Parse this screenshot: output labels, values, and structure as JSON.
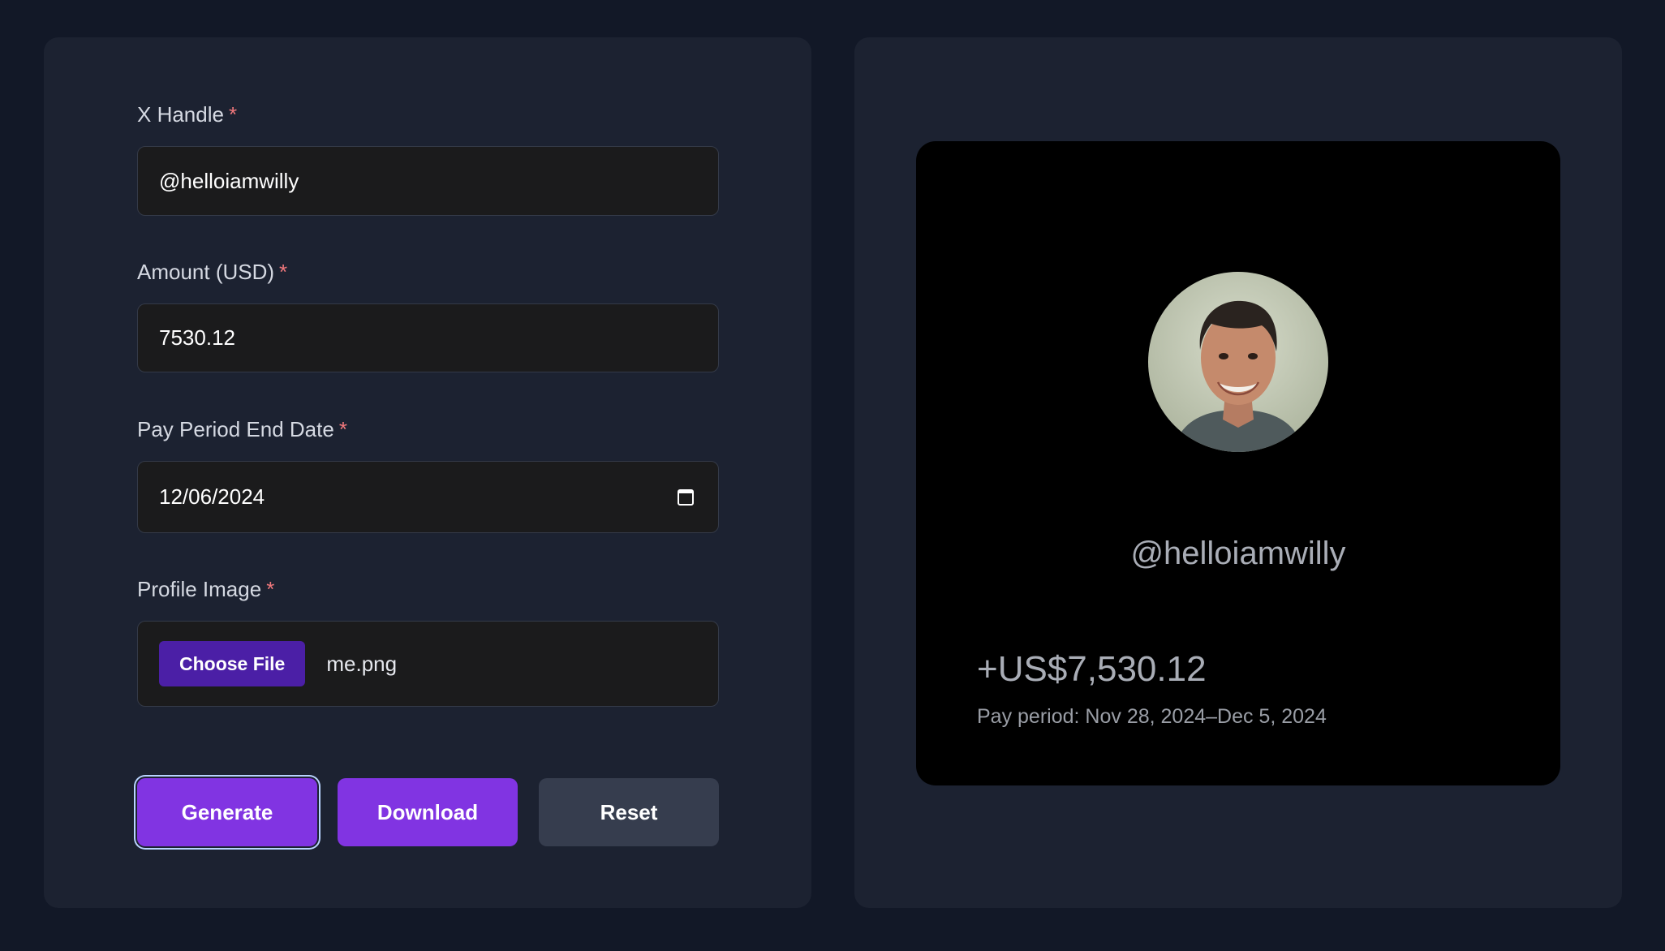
{
  "form": {
    "handle": {
      "label": "X Handle",
      "required_mark": "*",
      "value": "@helloiamwilly"
    },
    "amount": {
      "label": "Amount (USD)",
      "required_mark": "*",
      "value": "7530.12"
    },
    "end_date": {
      "label": "Pay Period End Date",
      "required_mark": "*",
      "value": "12/06/2024",
      "icon": "calendar-icon"
    },
    "profile_image": {
      "label": "Profile Image",
      "required_mark": "*",
      "button_label": "Choose File",
      "file_name": "me.png"
    }
  },
  "actions": {
    "generate_label": "Generate",
    "download_label": "Download",
    "reset_label": "Reset"
  },
  "preview": {
    "handle": "@helloiamwilly",
    "amount": "+US$7,530.12",
    "period": "Pay period: Nov 28, 2024–Dec 5, 2024"
  },
  "colors": {
    "background": "#121827",
    "panel": "#1c2231",
    "input_bg": "#1b1b1c",
    "accent": "#8134e2",
    "file_button": "#4b1fa6",
    "reset": "#363d4e",
    "required": "#f0787c",
    "card": "#000000"
  }
}
